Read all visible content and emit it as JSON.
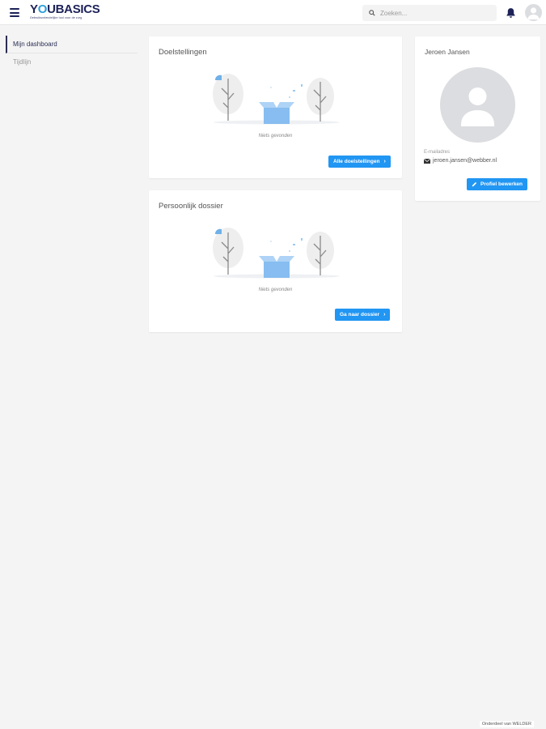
{
  "header": {
    "menu_icon": "hamburger-icon",
    "logo": {
      "text_part1": "Y",
      "text_o": "O",
      "text_part2": "UBASICS",
      "tagline": "Gebruiksvriendelijke tool voor de zorg"
    },
    "search": {
      "placeholder": "Zoeken...",
      "icon": "search-icon"
    },
    "notification_icon": "bell-icon",
    "avatar_icon": "user-avatar-icon"
  },
  "sidebar": {
    "items": [
      {
        "label": "Mijn dashboard",
        "active": true
      },
      {
        "label": "Tijdlijn",
        "active": false
      }
    ]
  },
  "cards": {
    "goals": {
      "title": "Doelstellingen",
      "empty_text": "Niets gevonden",
      "button_label": "Alle doelstellingen"
    },
    "dossier": {
      "title": "Persoonlijk dossier",
      "empty_text": "Niets gevonden",
      "button_label": "Ga naar dossier"
    },
    "profile": {
      "name": "Jeroen Jansen",
      "email_label": "E-mailadres",
      "email": "jeroen.jansen@webber.nl",
      "button_label": "Profiel bewerken"
    }
  },
  "footer": {
    "text": "Onderdeel van WELDER"
  },
  "colors": {
    "brand_navy": "#1d2258",
    "brand_blue": "#2d9cdb",
    "button_blue": "#2196f3",
    "background": "#f4f4f4"
  }
}
